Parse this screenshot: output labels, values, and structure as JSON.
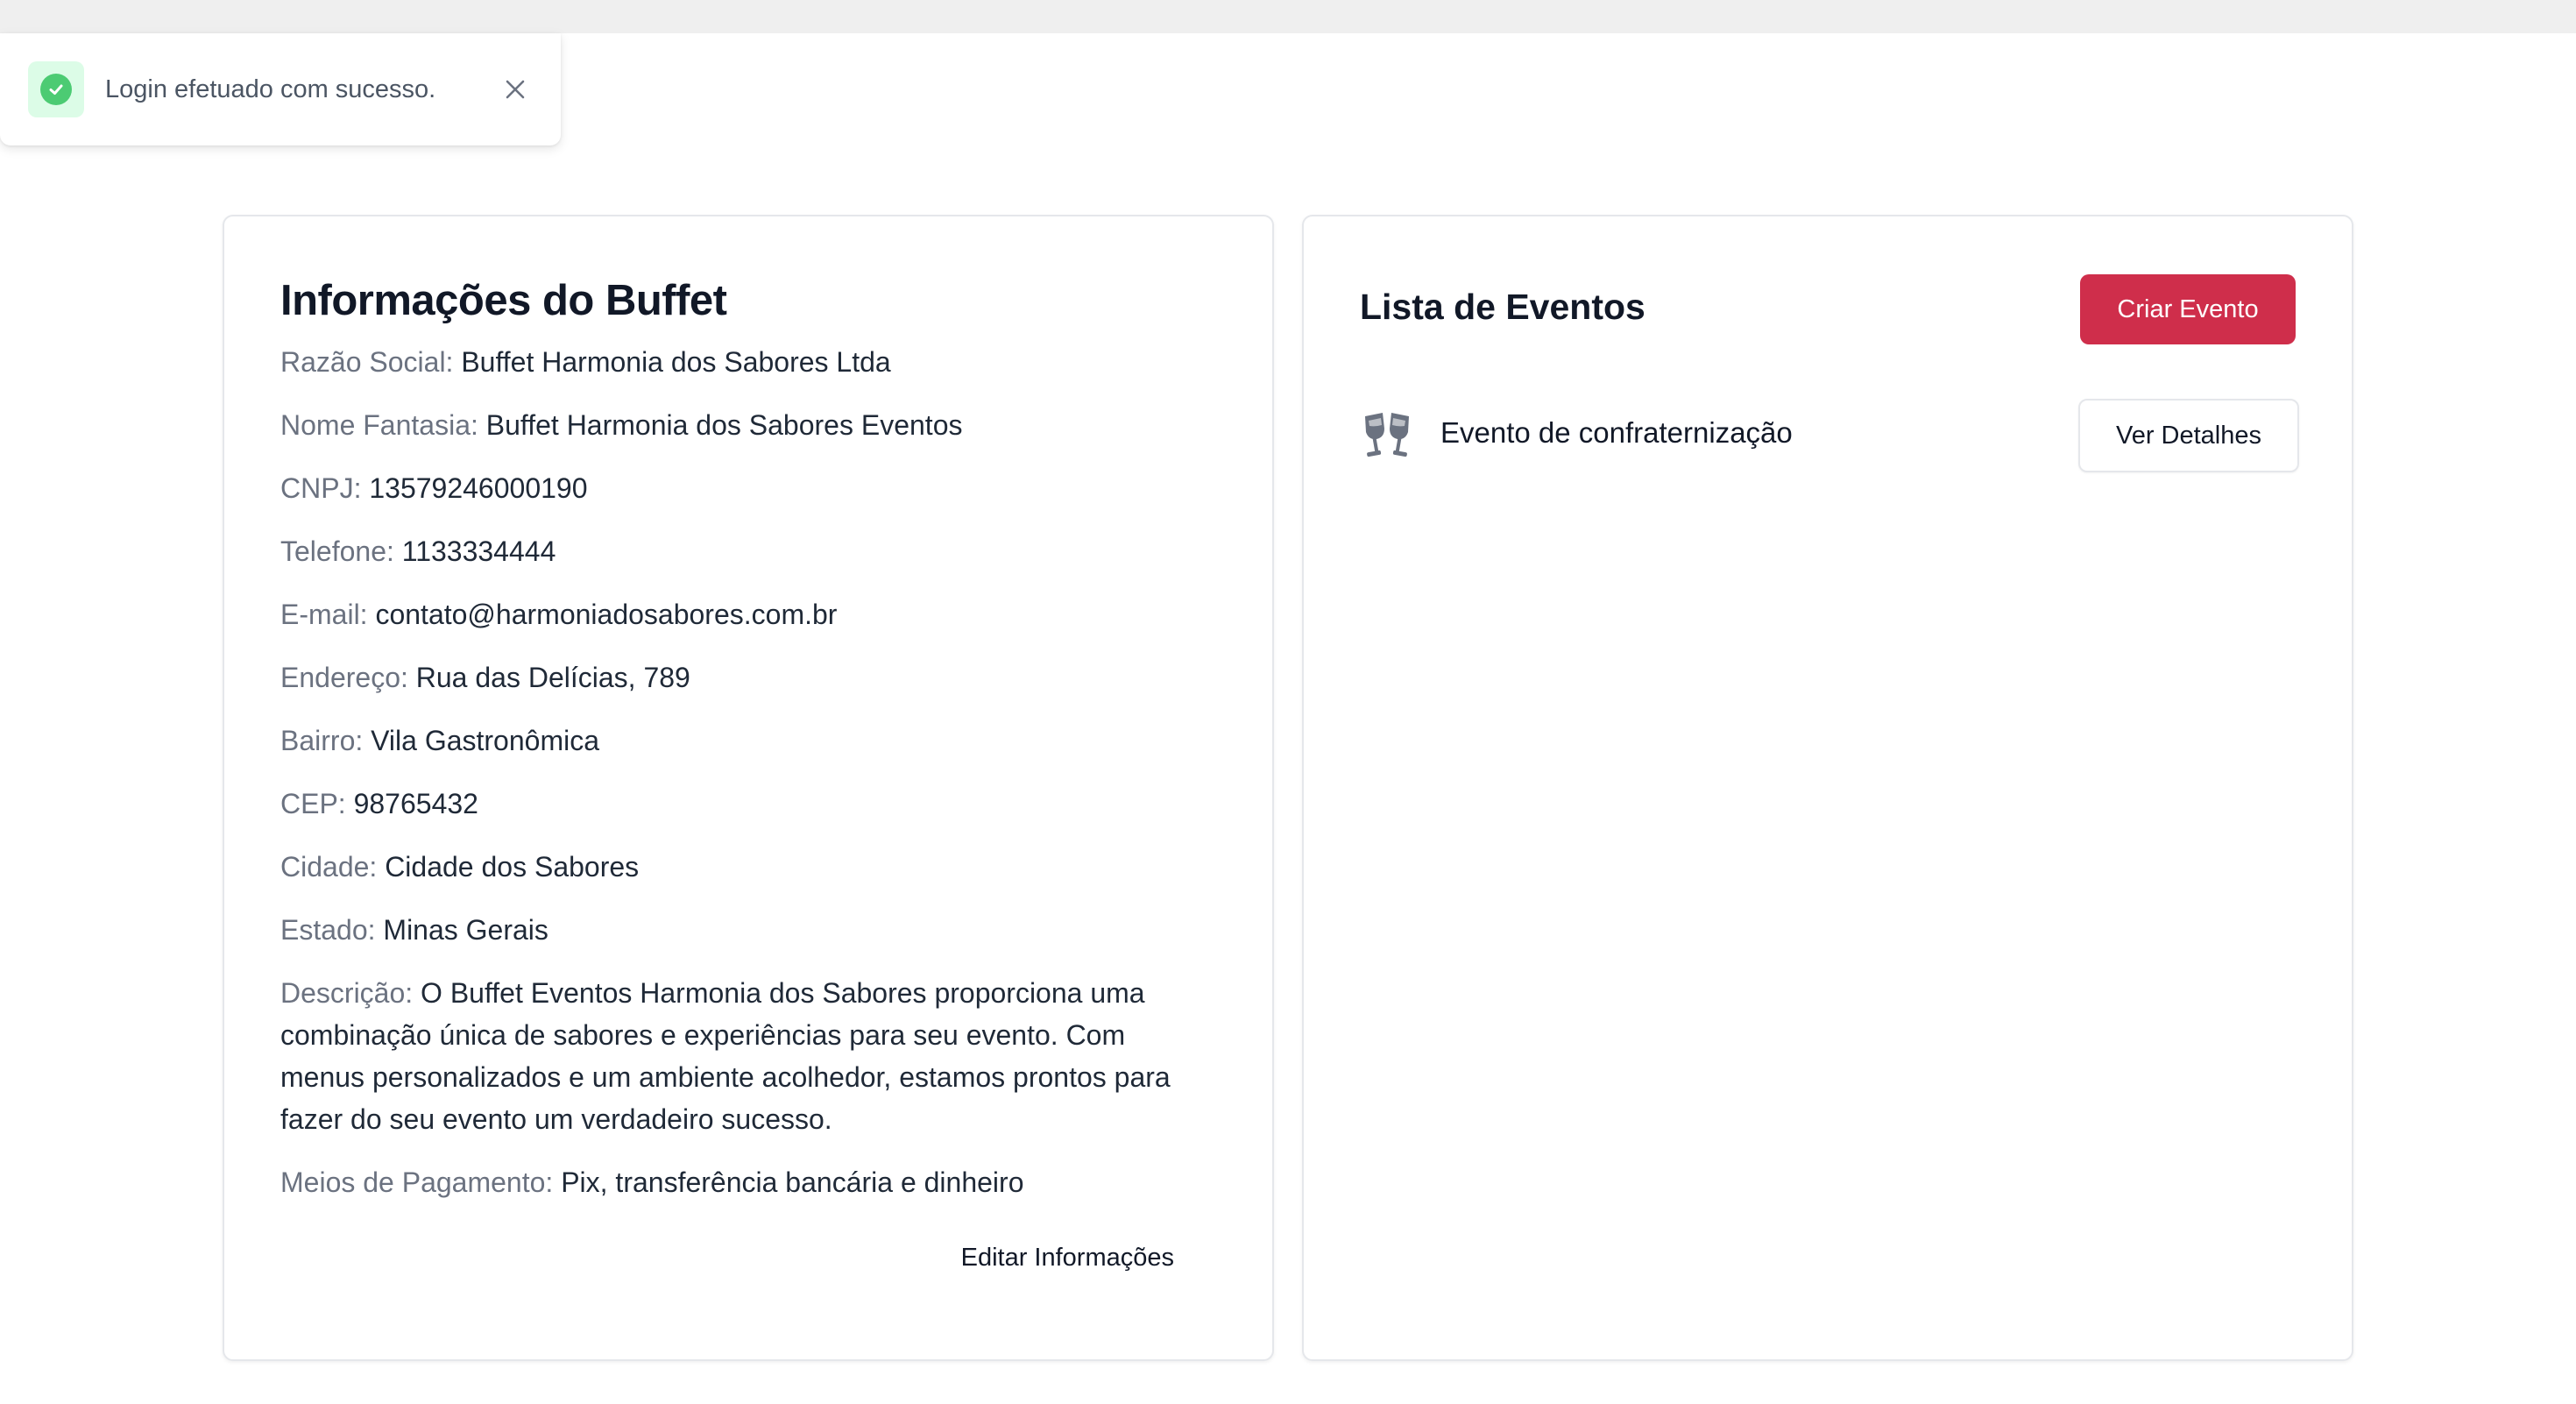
{
  "toast": {
    "message": "Login efetuado com sucesso.",
    "icon": "check-circle-icon",
    "close_icon": "close-icon",
    "success_color": "#4ccb73"
  },
  "buffet": {
    "title": "Informações do Buffet",
    "fields": [
      {
        "label": "Razão Social:",
        "value": "Buffet Harmonia dos Sabores Ltda"
      },
      {
        "label": "Nome Fantasia:",
        "value": "Buffet Harmonia dos Sabores Eventos"
      },
      {
        "label": "CNPJ:",
        "value": "13579246000190"
      },
      {
        "label": "Telefone:",
        "value": "1133334444"
      },
      {
        "label": "E-mail:",
        "value": "contato@harmoniadosabores.com.br"
      },
      {
        "label": "Endereço:",
        "value": "Rua das Delícias, 789"
      },
      {
        "label": "Bairro:",
        "value": "Vila Gastronômica"
      },
      {
        "label": "CEP:",
        "value": "98765432"
      },
      {
        "label": "Cidade:",
        "value": "Cidade dos Sabores"
      },
      {
        "label": "Estado:",
        "value": "Minas Gerais"
      },
      {
        "label": "Descrição:",
        "value": "O Buffet Eventos Harmonia dos Sabores proporciona uma combinação única de sabores e experiências para seu evento. Com menus personalizados e um ambiente acolhedor, estamos prontos para fazer do seu evento um verdadeiro sucesso."
      },
      {
        "label": "Meios de Pagamento:",
        "value": "Pix, transferência bancária e dinheiro"
      }
    ],
    "edit_label": "Editar Informações"
  },
  "events": {
    "title": "Lista de Eventos",
    "create_label": "Criar Evento",
    "accent_color": "#cf2e4b",
    "items": [
      {
        "name": "Evento de confraternização",
        "icon": "champagne-glasses-icon",
        "details_label": "Ver Detalhes"
      }
    ]
  }
}
